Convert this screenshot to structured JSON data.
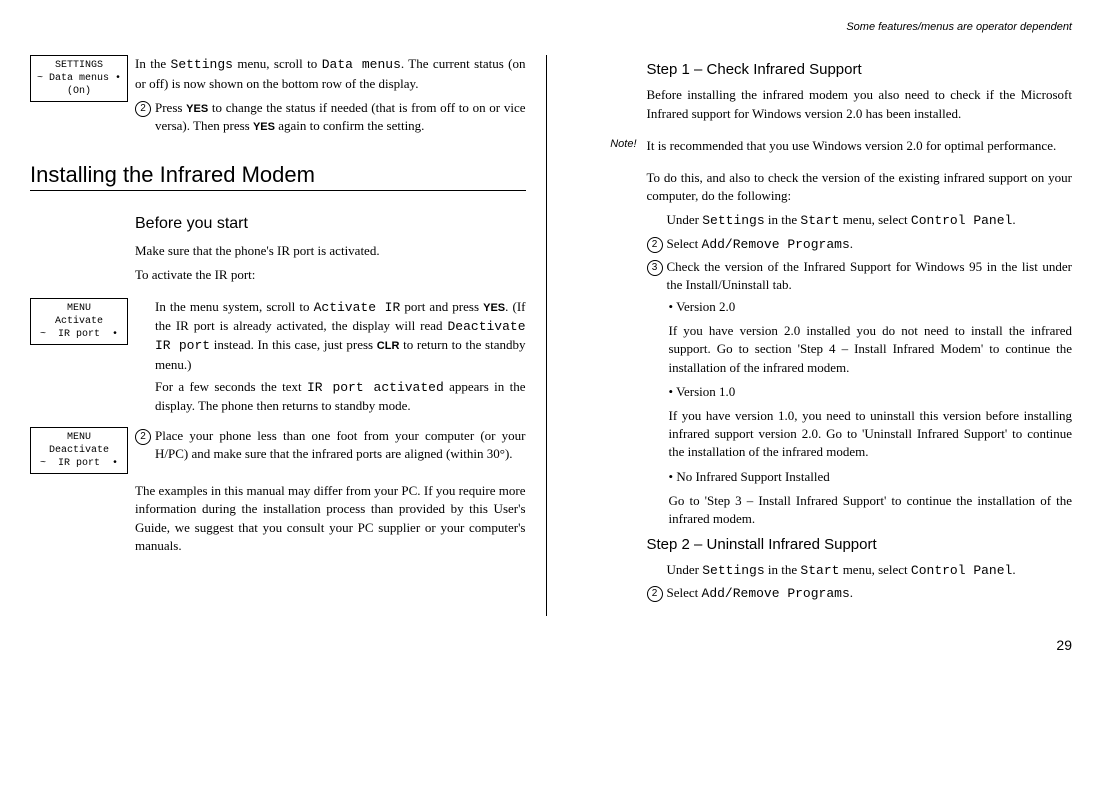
{
  "header_note": "Some features/menus are operator dependent",
  "page_number": "29",
  "left": {
    "box1": {
      "l1": "SETTINGS",
      "l2": "~ Data menus •",
      "l3": "(On)"
    },
    "intro1": "In the ",
    "intro1_mono": "Settings",
    "intro1_b": " menu, scroll to ",
    "intro1_mono2": "Data menus",
    "intro1_c": ". The current status (on or off) is now shown on the bottom row of the display.",
    "step2a": "Press ",
    "step2_key": "YES",
    "step2b": " to change the status if needed (that is from off to on or vice versa). Then press ",
    "step2_key2": "YES",
    "step2c": " again to confirm the setting.",
    "h1": "Installing the Infrared Modem",
    "h2": "Before you start",
    "para1": "Make sure that the phone's IR port is activated.",
    "para2": "To activate the IR port:",
    "box2": {
      "l1": "MENU",
      "l2": "Activate",
      "l3": "~  IR port  •"
    },
    "inst1a": "In the menu system, scroll to ",
    "inst1_mono": "Activate IR",
    "inst1b": " port and press ",
    "inst1_key": "YES",
    "inst1c": ". (If the IR port is already activated, the display will read ",
    "inst1_mono2": "Deactivate IR port",
    "inst1d": " instead. In this case, just press ",
    "inst1_key2": "CLR",
    "inst1e": " to return to the standby menu.)",
    "inst2a": "For a few seconds the text ",
    "inst2_mono": "IR port activated",
    "inst2b": " appears in the display. The phone then returns to standby mode.",
    "box3": {
      "l1": "MENU",
      "l2": "Deactivate",
      "l3": "~  IR port  •"
    },
    "inst3": " Place your phone less than one foot from your computer (or your H/PC) and make sure that the infrared ports are aligned (within 30°).",
    "para3": "The examples in this manual may differ from your PC. If you require more information during the installation process than provided by this User's Guide, we suggest that you consult your PC supplier or your computer's manuals."
  },
  "right": {
    "step1_h": "Step 1 – Check Infrared Support",
    "step1_p1": "Before installing the infrared modem you also need to check if the Microsoft Infrared support for Windows version 2.0 has been installed.",
    "note_label": "Note!",
    "note_text": "It is recommended that you use Windows version 2.0 for optimal performance.",
    "step1_p2": "To do this, and also to check the version of the existing infrared support on your computer, do the following:",
    "s1_l1a": "Under ",
    "s1_l1m1": "Settings",
    "s1_l1b": " in the ",
    "s1_l1m2": "Start",
    "s1_l1c": " menu, select ",
    "s1_l1m3": "Control Panel",
    "s1_l1d": ".",
    "s1_l2a": "Select ",
    "s1_l2m": "Add/Remove Programs",
    "s1_l2b": ".",
    "s1_l3": "Check the version of the Infrared Support for Windows 95 in the list under the Install/Uninstall tab.",
    "s1_b1": "Version 2.0",
    "s1_b1t": "If you have version 2.0 installed you do not need to install the infrared support. Go to section 'Step 4 – Install Infrared Modem' to continue the installation of the infrared modem.",
    "s1_b2": "Version 1.0",
    "s1_b2t": "If you have version 1.0, you need to uninstall this version before installing infrared support version 2.0. Go to 'Uninstall Infrared Support' to continue the installation of the infrared modem.",
    "s1_b3": "No Infrared Support Installed",
    "s1_b3t": "Go to 'Step 3 – Install Infrared Support' to continue the installation of the infrared modem.",
    "step2_h": "Step 2 – Uninstall Infrared Support",
    "s2_l1a": "Under ",
    "s2_l1m1": "Settings",
    "s2_l1b": " in the ",
    "s2_l1m2": "Start",
    "s2_l1c": " menu, select ",
    "s2_l1m3": "Control Panel",
    "s2_l1d": ".",
    "s2_l2a": "Select ",
    "s2_l2m": "Add/Remove Programs",
    "s2_l2b": "."
  }
}
